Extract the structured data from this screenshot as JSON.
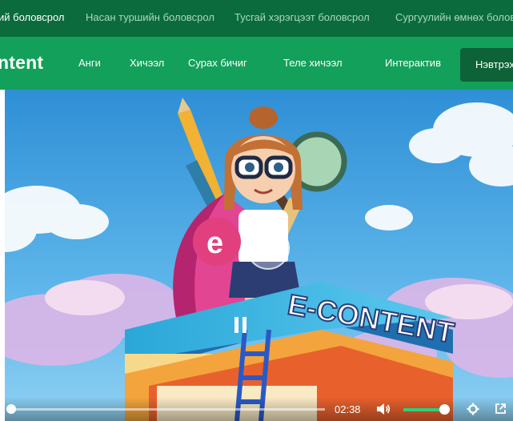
{
  "topbar": {
    "items": [
      {
        "label": "ий боловсрол",
        "active": true
      },
      {
        "label": "Насан туршийн боловсрол",
        "active": false
      },
      {
        "label": "Тусгай хэрэгцээт боловсрол",
        "active": false
      },
      {
        "label": "Сургуулийн өмнөх боловсрол",
        "active": false
      }
    ]
  },
  "navbar": {
    "brand": "ntent",
    "items": [
      "Анги",
      "Хичээл",
      "Сурах бичиг",
      "Теле хичээл",
      "Интерактив"
    ],
    "signin_label": "Нэвтрэх"
  },
  "video": {
    "banner_text": "E-CONTENT",
    "badge_letter": "e",
    "time": "02:38",
    "progress": 0.0,
    "volume": 0.88,
    "colors": {
      "accent": "#13a05a",
      "dark": "#0b6b3d",
      "volume": "#2fd07a"
    }
  }
}
